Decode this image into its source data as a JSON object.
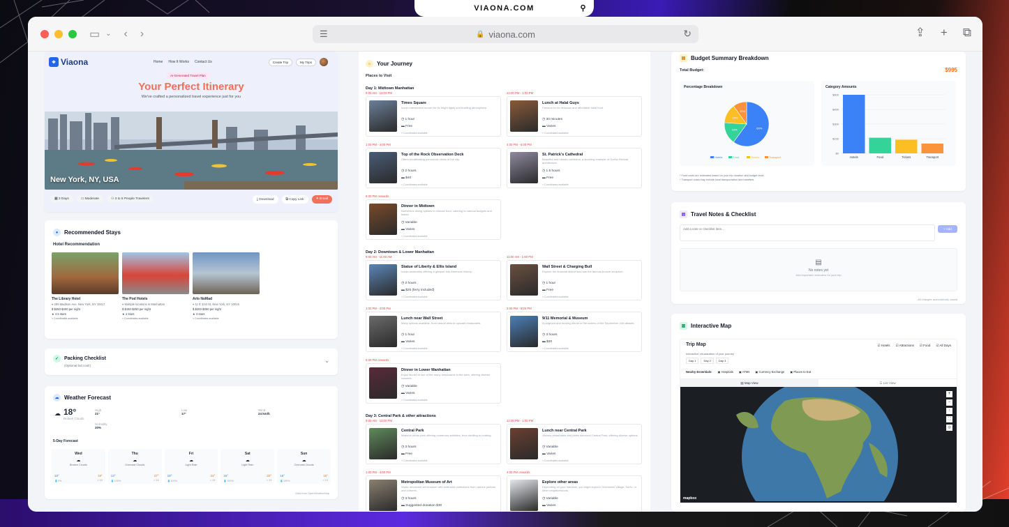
{
  "banner": {
    "url": "VIAONA.COM"
  },
  "browser": {
    "address": "viaona.com"
  },
  "nav": {
    "logo": "Viaona",
    "links": [
      "Home",
      "How It Works",
      "Contact Us"
    ],
    "create": "Create Trip",
    "mytrips": "My Trips"
  },
  "hero": {
    "badge": "AI-Generated Travel Plan",
    "title": "Your Perfect Itinerary",
    "subtitle": "We've crafted a personalized travel experience just for you",
    "city": "New York, NY, USA",
    "chips": [
      "3 Days",
      "Moderate",
      "3 to 5 People Travelers"
    ],
    "actions": [
      "Download",
      "Copy Link",
      "Email"
    ]
  },
  "stays": {
    "title": "Recommended Stays",
    "subtitle": "Hotel Recommendation",
    "hotels": [
      {
        "name": "The Library Hotel",
        "addr": "299 Madison Ave, New York, NY 10017",
        "price": "$250-$400 per night",
        "rating": "4.5 stars",
        "coord": "Coordinates available"
      },
      {
        "name": "The Pod Hotels",
        "addr": "Multiple locations in Manhattan",
        "price": "$150-$250 per night",
        "rating": "4 stars",
        "coord": "Coordinates available"
      },
      {
        "name": "Arlo NoMad",
        "addr": "11 E 31st St, New York, NY 10016",
        "price": "$200-$350 per night",
        "rating": "4 stars",
        "coord": "Coordinates available"
      }
    ]
  },
  "packing": {
    "title": "Packing Checklist",
    "sub": "(Optional but cool!)"
  },
  "weather": {
    "title": "Weather Forecast",
    "temp": "18°",
    "cond": "Broken Clouds",
    "high_l": "High",
    "high": "21°",
    "low_l": "Low",
    "low": "17°",
    "wind_l": "Wind",
    "wind": "24 km/h",
    "hum_l": "Humidity",
    "hum": "20%",
    "fc_title": "5-Day Forecast",
    "days": [
      {
        "d": "Wed",
        "c": "Broken Clouds",
        "lo": "18°",
        "hi": "19°",
        "p": "0%",
        "w": "18"
      },
      {
        "d": "Thu",
        "c": "Overcast Clouds",
        "lo": "13°",
        "hi": "27°",
        "p": "100%",
        "w": "14"
      },
      {
        "d": "Fri",
        "c": "Light Rain",
        "lo": "18°",
        "hi": "24°",
        "p": "100%",
        "w": "13"
      },
      {
        "d": "Sat",
        "c": "Light Rain",
        "lo": "16°",
        "hi": "20°",
        "p": "100%",
        "w": "13"
      },
      {
        "d": "Sun",
        "c": "Overcast Clouds",
        "lo": "16°",
        "hi": "18°",
        "p": "100%",
        "w": "13"
      }
    ],
    "src": "Data from OpenWeatherMap"
  },
  "journey": {
    "title": "Your Journey",
    "places": "Places to Visit",
    "days": [
      {
        "title": "Day 1: Midtown Manhattan",
        "items": [
          {
            "time": "9:00 AM - 12:00 PM",
            "name": "Times Square",
            "desc": "Iconic intersection known for its bright lights and bustling atmosphere.",
            "dur": "1 hour",
            "price": "Free"
          },
          {
            "time": "12:00 PM - 1:00 PM",
            "name": "Lunch at Halal Guys",
            "desc": "Famous for its delicious and affordable halal food.",
            "dur": "30 minutes",
            "price": "Varies"
          },
          {
            "time": "1:00 PM - 4:00 PM",
            "name": "Top of the Rock Observation Deck",
            "desc": "Offers breathtaking panoramic views of the city.",
            "dur": "2 hours",
            "price": "$40"
          },
          {
            "time": "4:00 PM - 6:00 PM",
            "name": "St. Patrick's Cathedral",
            "desc": "Beautiful and historic cathedral, a stunning example of Gothic Revival architecture.",
            "dur": "1.5 hours",
            "price": "Free"
          },
          {
            "time": "6:00 PM onwards",
            "name": "Dinner in Midtown",
            "desc": "Numerous dining options to choose from, catering to various budgets and tastes.",
            "dur": "Variable",
            "price": "Varies"
          }
        ]
      },
      {
        "title": "Day 2: Downtown & Lower Manhattan",
        "items": [
          {
            "time": "9:00 AM - 11:00 AM",
            "name": "Statue of Liberty & Ellis Island",
            "desc": "Iconic landmarks offering a glimpse into American history.",
            "dur": "2 hours",
            "price": "$25 (ferry included)"
          },
          {
            "time": "11:00 AM - 1:00 PM",
            "name": "Wall Street & Charging Bull",
            "desc": "Explore the financial district and see the famous bronze sculpture.",
            "dur": "1 hour",
            "price": "Free"
          },
          {
            "time": "1:00 PM - 2:00 PM",
            "name": "Lunch near Wall Street",
            "desc": "Many options available, from casual delis to upscale restaurants.",
            "dur": "1 hour",
            "price": "Varies"
          },
          {
            "time": "2:00 PM - 5:00 PM",
            "name": "9/11 Memorial & Museum",
            "desc": "A poignant and moving tribute to the victims of the September 11th attacks.",
            "dur": "3 hours",
            "price": "$30"
          },
          {
            "time": "5:00 PM onwards",
            "name": "Dinner in Lower Manhattan",
            "desc": "Enjoy dinner at one of the many restaurants in the area, offering diverse cuisines.",
            "dur": "Variable",
            "price": "Varies"
          }
        ]
      },
      {
        "title": "Day 3: Central Park & other attractions",
        "items": [
          {
            "time": "9:00 AM - 12:00 PM",
            "name": "Central Park",
            "desc": "Massive urban park offering numerous activities, from strolling to boating.",
            "dur": "3 hours",
            "price": "Free"
          },
          {
            "time": "12:00 PM - 1:00 PM",
            "name": "Lunch near Central Park",
            "desc": "Various restaurants and cafes surround Central Park, offering diverse options.",
            "dur": "Variable",
            "price": "Varies"
          },
          {
            "time": "1:00 PM - 4:00 PM",
            "name": "Metropolitan Museum of Art",
            "desc": "World-renowned art museum with extensive collections from various periods and cultures.",
            "dur": "3 hours",
            "price": "Suggested donation $30"
          },
          {
            "time": "4:00 PM onwards",
            "name": "Explore other areas",
            "desc": "Depending on your interests, you might explore Greenwich Village, SoHo, or other neighborhoods.",
            "dur": "Variable",
            "price": "Varies"
          }
        ]
      }
    ],
    "coord": "Coordinates available"
  },
  "budget": {
    "title": "Budget Summary Breakdown",
    "total_l": "Total Budget:",
    "total": "$995",
    "pct_title": "Percentage Breakdown",
    "amt_title": "Category Amounts",
    "notes": [
      "* Food costs are estimated based on your trip duration and budget level.",
      "* Transport costs may include local transportation and transfers."
    ]
  },
  "chart_data": [
    {
      "type": "pie",
      "title": "Percentage Breakdown",
      "labels": [
        "Hotels",
        "Food",
        "Tickets",
        "Transport"
      ],
      "values": [
        60,
        16,
        14,
        10
      ],
      "colors": [
        "#3b82f6",
        "#34d399",
        "#fbbf24",
        "#fb923c"
      ]
    },
    {
      "type": "bar",
      "title": "Category Amounts",
      "categories": [
        "Hotels",
        "Food",
        "Tickets",
        "Transport"
      ],
      "values": [
        600,
        160,
        140,
        100
      ],
      "yticks": [
        "$0",
        "$150",
        "$300",
        "$450",
        "$600"
      ],
      "ylim": [
        0,
        600
      ],
      "colors": [
        "#3b82f6",
        "#34d399",
        "#fbbf24",
        "#fb923c"
      ]
    }
  ],
  "notes": {
    "title": "Travel Notes & Checklist",
    "placeholder": "Add a note or checklist item...",
    "add": "+ Add",
    "empty": "No notes yet",
    "empty_sub": "Add important reminders for your trip",
    "saved": "All changes automatically saved"
  },
  "map": {
    "title": "Interactive Map",
    "card_title": "Trip Map",
    "sub": "Interactive visualization of your journey",
    "filters": [
      "Hotels",
      "Attractions",
      "Food",
      "All Days"
    ],
    "daybtns": [
      "Day 1",
      "Day 2",
      "Day 3"
    ],
    "ess_l": "Nearby Essentials:",
    "ess": [
      "Hospitals",
      "ATMs",
      "Currency Exchange",
      "Places to Eat"
    ],
    "tab_map": "Map View",
    "tab_list": "List View",
    "credit": "mapbox"
  }
}
